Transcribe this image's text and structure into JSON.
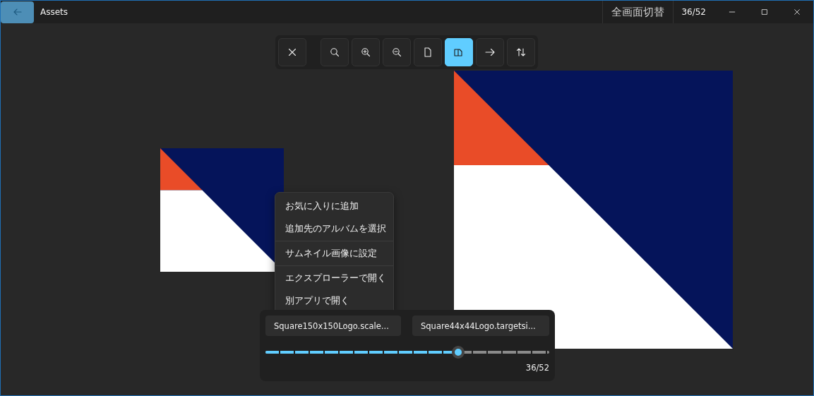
{
  "window": {
    "title": "Assets",
    "fullscreen_toggle": "全画面切替",
    "counter": "36/52"
  },
  "toolbar": {
    "buttons": [
      {
        "kind": "close",
        "selected": false
      },
      {
        "kind": "zoom-fit",
        "selected": false
      },
      {
        "kind": "zoom-in",
        "selected": false
      },
      {
        "kind": "zoom-out",
        "selected": false
      },
      {
        "kind": "single",
        "selected": false
      },
      {
        "kind": "compare",
        "selected": true
      },
      {
        "kind": "next",
        "selected": false
      },
      {
        "kind": "swap",
        "selected": false
      }
    ]
  },
  "context_menu": {
    "items": [
      {
        "kind": "item",
        "label": "お気に入りに追加"
      },
      {
        "kind": "item",
        "label": "追加先のアルバムを選択"
      },
      {
        "kind": "separator"
      },
      {
        "kind": "item",
        "label": "サムネイル画像に設定"
      },
      {
        "kind": "separator"
      },
      {
        "kind": "item",
        "label": "エクスプローラーで開く"
      },
      {
        "kind": "item",
        "label": "別アプリで開く"
      }
    ]
  },
  "compare_panel": {
    "left_file": "Square150x150Logo.scale...",
    "right_file": "Square44x44Logo.targetsi...",
    "slider": {
      "level": 0.68
    },
    "position": "36/52"
  }
}
